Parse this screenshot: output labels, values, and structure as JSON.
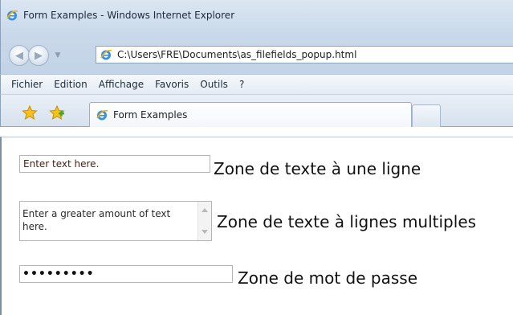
{
  "window": {
    "title": "Form Examples - Windows Internet Explorer"
  },
  "navigation": {
    "back_icon": "back-arrow-icon",
    "forward_icon": "forward-arrow-icon",
    "address": "C:\\Users\\FRE\\Documents\\as_filefields_popup.html"
  },
  "menu": {
    "items": [
      "Fichier",
      "Edition",
      "Affichage",
      "Favoris",
      "Outils",
      "?"
    ]
  },
  "tabs": {
    "active_label": "Form Examples"
  },
  "form": {
    "text_input": {
      "value": "Enter text here.",
      "label": "Zone de texte à une ligne"
    },
    "textarea": {
      "value": "Enter a greater amount of text here.",
      "label": "Zone de texte à lignes multiples"
    },
    "password": {
      "value": "•••••••••",
      "label": "Zone de mot de passe"
    }
  },
  "colors": {
    "frame": "#c9d9ea",
    "accent_border": "#8aa0bb",
    "input_text": "#4b2016"
  }
}
